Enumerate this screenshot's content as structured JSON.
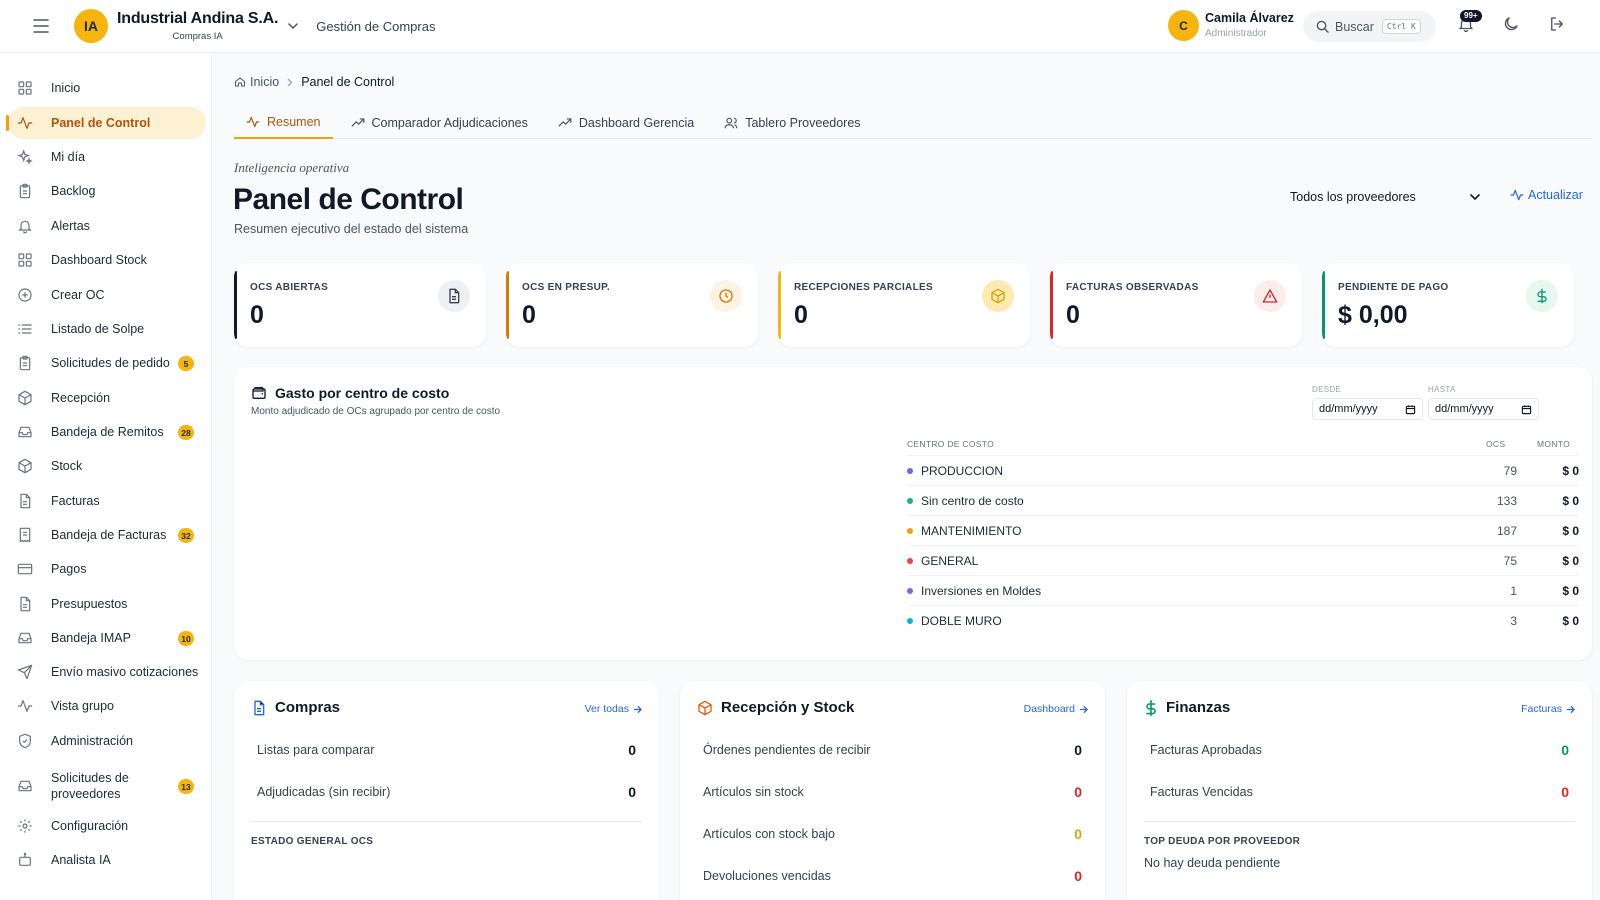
{
  "header": {
    "logo_text": "IA",
    "company": "Industrial Andina S.A.",
    "company_sub": "Compras IA",
    "module": "Gestión de Compras",
    "user_initial": "C",
    "user_name": "Camila Álvarez",
    "user_role": "Administrador",
    "search_label": "Buscar",
    "search_kbd": "Ctrl K",
    "notif_badge": "99+"
  },
  "sidebar": {
    "items": [
      {
        "label": "Inicio",
        "icon": "grid-icon"
      },
      {
        "label": "Panel de Control",
        "icon": "activity-icon",
        "active": true
      },
      {
        "label": "Mi día",
        "icon": "sparkles-icon"
      },
      {
        "label": "Backlog",
        "icon": "clipboard-icon"
      },
      {
        "label": "Alertas",
        "icon": "bell-icon"
      },
      {
        "label": "Dashboard Stock",
        "icon": "grid-icon"
      },
      {
        "label": "Crear OC",
        "icon": "plus-circle-icon"
      },
      {
        "label": "Listado de Solpe",
        "icon": "list-icon"
      },
      {
        "label": "Solicitudes de pedido",
        "icon": "clipboard-icon",
        "badge": "5"
      },
      {
        "label": "Recepción",
        "icon": "package-icon"
      },
      {
        "label": "Bandeja de Remitos",
        "icon": "inbox-icon",
        "badge": "28"
      },
      {
        "label": "Stock",
        "icon": "package-icon"
      },
      {
        "label": "Facturas",
        "icon": "file-text-icon"
      },
      {
        "label": "Bandeja de Facturas",
        "icon": "receipt-icon",
        "badge": "32"
      },
      {
        "label": "Pagos",
        "icon": "credit-card-icon"
      },
      {
        "label": "Presupuestos",
        "icon": "file-text-icon"
      },
      {
        "label": "Bandeja IMAP",
        "icon": "inbox-icon",
        "badge": "10"
      },
      {
        "label": "Envío masivo cotizaciones",
        "icon": "send-icon"
      },
      {
        "label": "Vista grupo",
        "icon": "activity-icon"
      },
      {
        "label": "Administración",
        "icon": "shield-icon"
      },
      {
        "label": "Solicitudes de proveedores",
        "icon": "inbox-icon",
        "badge": "13"
      },
      {
        "label": "Configuración",
        "icon": "gear-icon"
      },
      {
        "label": "Analista IA",
        "icon": "bot-icon"
      }
    ]
  },
  "breadcrumb": {
    "home": "Inicio",
    "current": "Panel de Control"
  },
  "tabs": [
    {
      "label": "Resumen",
      "icon": "activity-icon",
      "active": true
    },
    {
      "label": "Comparador Adjudicaciones",
      "icon": "trending-up-icon"
    },
    {
      "label": "Dashboard Gerencia",
      "icon": "trending-up-icon"
    },
    {
      "label": "Tablero Proveedores",
      "icon": "users-icon"
    }
  ],
  "page": {
    "kicker": "Inteligencia operativa",
    "title": "Panel de Control",
    "subtitle": "Resumen ejecutivo del estado del sistema",
    "provider_filter": "Todos los proveedores",
    "refresh_label": "Actualizar"
  },
  "kpis": [
    {
      "label": "OCS ABIERTAS",
      "value": "0",
      "icon": "file-text-icon",
      "color": "#111827",
      "icon_bg": "#eef0f3",
      "icon_color": "#374151"
    },
    {
      "label": "OCS EN PRESUP.",
      "value": "0",
      "icon": "clock-icon",
      "color": "#d97706",
      "icon_bg": "#fdf3e3",
      "icon_color": "#d97706"
    },
    {
      "label": "RECEPCIONES PARCIALES",
      "value": "0",
      "icon": "box-icon",
      "color": "#f5b50d",
      "icon_bg": "#fdeab0",
      "icon_color": "#d4a20d"
    },
    {
      "label": "FACTURAS OBSERVADAS",
      "value": "0",
      "icon": "alert-triangle-icon",
      "color": "#dc2626",
      "icon_bg": "#fdecec",
      "icon_color": "#dc2626"
    },
    {
      "label": "PENDIENTE DE PAGO",
      "value": "$ 0,00",
      "icon": "dollar-icon",
      "color": "#059669",
      "icon_bg": "#e7f7ef",
      "icon_color": "#059669"
    }
  ],
  "gasto": {
    "title": "Gasto por centro de costo",
    "subtitle": "Monto adjudicado de OCs agrupado por centro de costo",
    "desde_label": "DESDE",
    "hasta_label": "HASTA",
    "desde_value": "dd/mm/yyyy",
    "hasta_value": "dd/mm/yyyy",
    "col_center": "CENTRO DE COSTO",
    "col_ocs": "OCS",
    "col_amount": "MONTO",
    "rows": [
      {
        "name": "PRODUCCION",
        "ocs": "79",
        "amount": "$ 0",
        "color": "#6366f1"
      },
      {
        "name": "Sin centro de costo",
        "ocs": "133",
        "amount": "$ 0",
        "color": "#10b981"
      },
      {
        "name": "MANTENIMIENTO",
        "ocs": "187",
        "amount": "$ 0",
        "color": "#f59e0b"
      },
      {
        "name": "GENERAL",
        "ocs": "75",
        "amount": "$ 0",
        "color": "#ef4444"
      },
      {
        "name": "Inversiones en Moldes",
        "ocs": "1",
        "amount": "$ 0",
        "color": "#8b5cf6"
      },
      {
        "name": "DOBLE MURO",
        "ocs": "3",
        "amount": "$ 0",
        "color": "#06b6d4"
      }
    ]
  },
  "compras": {
    "title": "Compras",
    "link": "Ver todas",
    "rows": [
      {
        "label": "Listas para comparar",
        "value": "0"
      },
      {
        "label": "Adjudicadas (sin recibir)",
        "value": "0"
      }
    ],
    "caption": "ESTADO GENERAL OCS"
  },
  "recepcion": {
    "title": "Recepción y Stock",
    "link": "Dashboard",
    "rows": [
      {
        "label": "Órdenes pendientes de recibir",
        "value": "0",
        "color": "#111827"
      },
      {
        "label": "Artículos sin stock",
        "value": "0",
        "color": "#dc2626"
      },
      {
        "label": "Artículos con stock bajo",
        "value": "0",
        "color": "#d4a20d"
      },
      {
        "label": "Devoluciones vencidas",
        "value": "0",
        "color": "#dc2626"
      }
    ]
  },
  "finanzas": {
    "title": "Finanzas",
    "link": "Facturas",
    "rows": [
      {
        "label": "Facturas Aprobadas",
        "value": "0",
        "color": "#059669"
      },
      {
        "label": "Facturas Vencidas",
        "value": "0",
        "color": "#dc2626"
      }
    ],
    "caption": "TOP DEUDA POR PROVEEDOR",
    "note": "No hay deuda pendiente"
  }
}
